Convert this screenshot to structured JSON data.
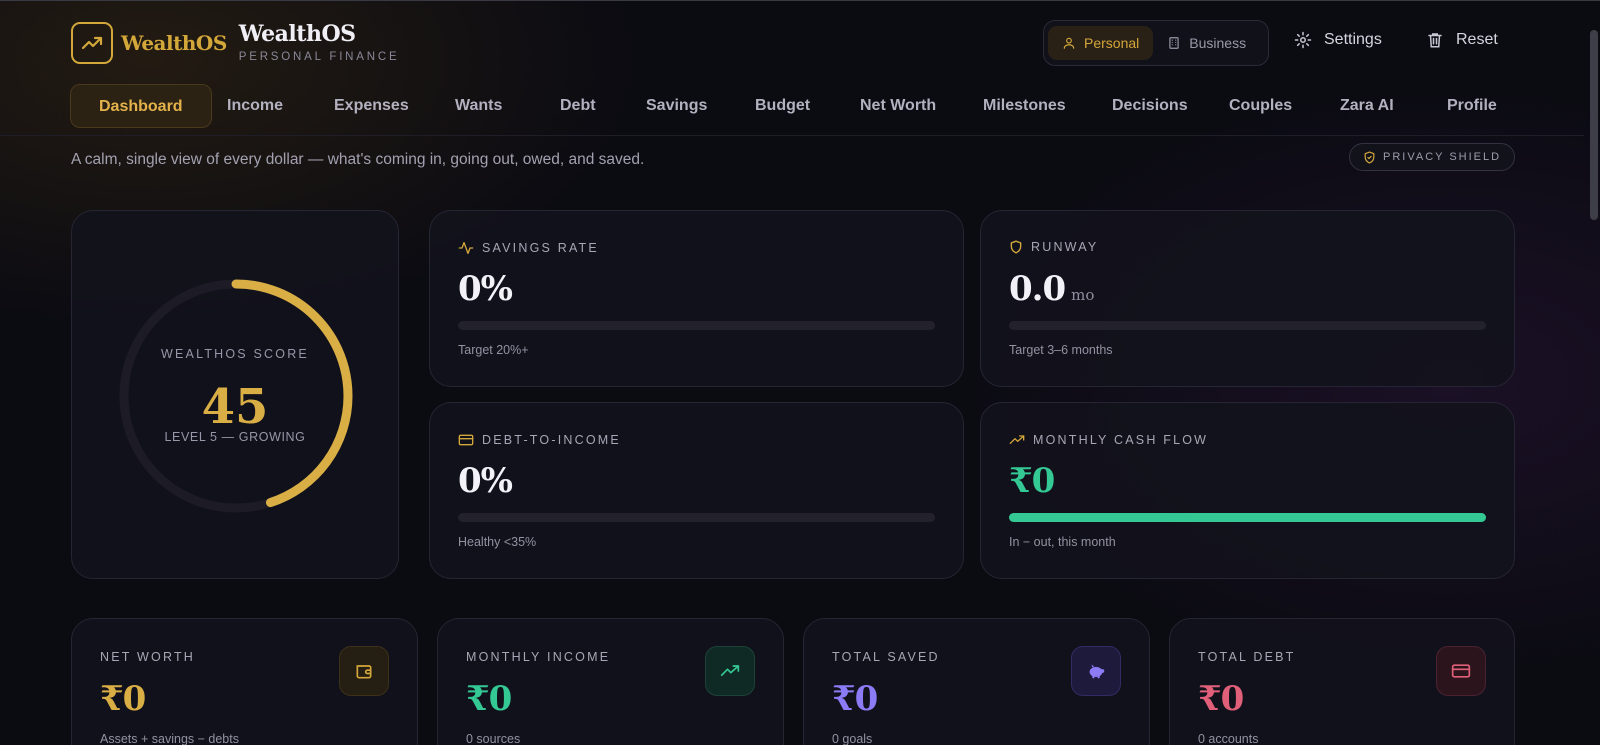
{
  "brand": {
    "logo_word": "WealthOS",
    "title": "WealthOS",
    "subtitle": "PERSONAL FINANCE"
  },
  "mode_toggle": {
    "personal_label": "Personal",
    "business_label": "Business",
    "selected": "Personal"
  },
  "header_actions": {
    "settings_label": "Settings",
    "reset_label": "Reset"
  },
  "nav": {
    "active": "Dashboard",
    "items": [
      "Dashboard",
      "Income",
      "Expenses",
      "Wants",
      "Debt",
      "Savings",
      "Budget",
      "Net Worth",
      "Milestones",
      "Decisions",
      "Couples",
      "Zara AI",
      "Profile"
    ]
  },
  "tagline": "A calm, single view of every dollar — what's coming in, going out, owed, and saved.",
  "privacy_badge": "PRIVACY SHIELD",
  "score": {
    "label": "WEALTHOS SCORE",
    "value": "45",
    "level": "LEVEL 5 — GROWING",
    "progress": 0.45
  },
  "metrics": {
    "savings_rate": {
      "label": "SAVINGS RATE",
      "value": "0%",
      "hint": "Target 20%+",
      "progress": 0
    },
    "runway": {
      "label": "RUNWAY",
      "value": "0.0",
      "unit": "mo",
      "hint": "Target 3–6 months",
      "progress": 0
    },
    "debt_to_income": {
      "label": "DEBT-TO-INCOME",
      "value": "0%",
      "hint": "Healthy <35%",
      "progress": 0
    },
    "cash_flow": {
      "label": "MONTHLY CASH FLOW",
      "value": "₹0",
      "hint": "In − out, this month",
      "progress": 1
    }
  },
  "stats": {
    "net_worth": {
      "label": "NET WORTH",
      "value": "₹0",
      "sub": "Assets + savings − debts",
      "icon": "wallet-icon"
    },
    "monthly_income": {
      "label": "MONTHLY INCOME",
      "value": "₹0",
      "sub": "0 sources",
      "icon": "trending-up-icon"
    },
    "total_saved": {
      "label": "TOTAL SAVED",
      "value": "₹0",
      "sub": "0 goals",
      "icon": "piggy-bank-icon"
    },
    "total_debt": {
      "label": "TOTAL DEBT",
      "value": "₹0",
      "sub": "0 accounts",
      "icon": "credit-card-icon"
    }
  },
  "colors": {
    "accent_gold": "#d4a73a",
    "green": "#34c994",
    "purple": "#8b7cf6",
    "red": "#e0607a",
    "background": "#0b0b12"
  }
}
